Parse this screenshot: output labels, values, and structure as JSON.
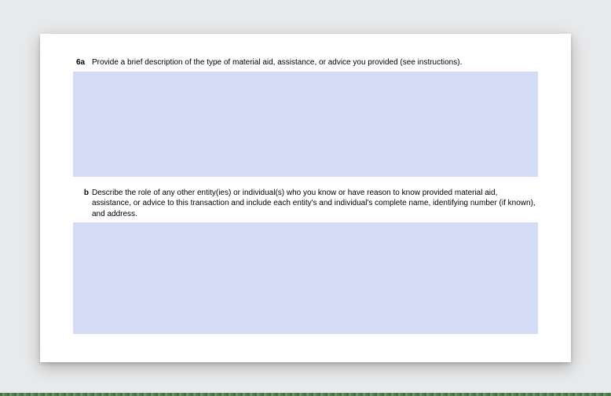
{
  "form": {
    "q6a": {
      "number": "6a",
      "text": "Provide a brief description of the type of material aid, assistance, or advice you provided (see instructions).",
      "value": ""
    },
    "q6b": {
      "number": "b",
      "text": "Describe the role of any other entity(ies) or individual(s) who you know or have reason to know provided material aid, assistance, or advice to this transaction and include each entity's and individual's complete name, identifying number (if known), and address.",
      "value": ""
    }
  }
}
